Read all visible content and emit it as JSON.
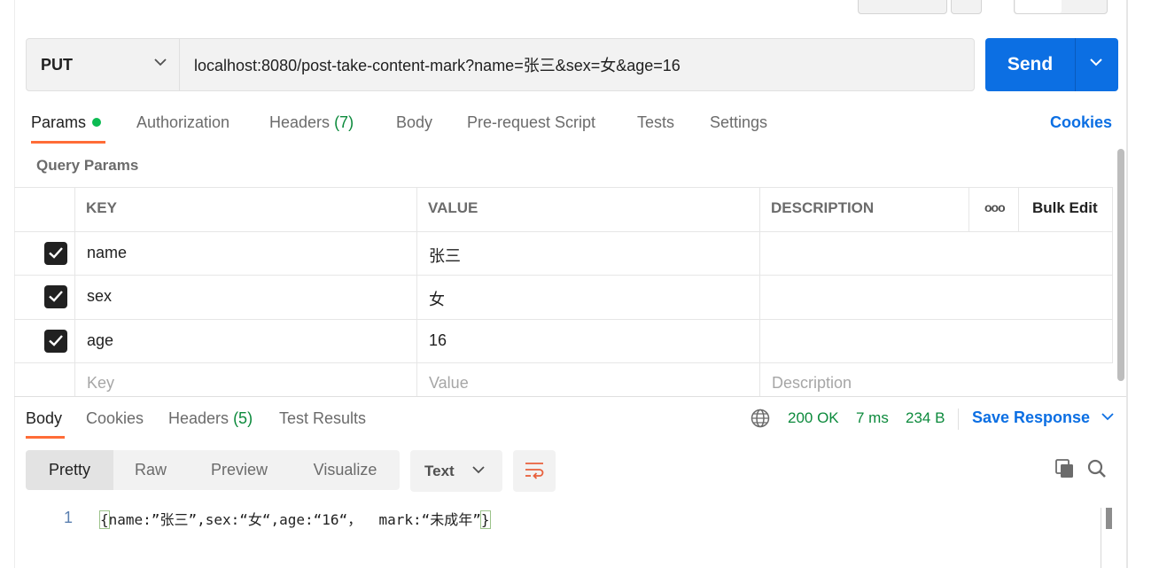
{
  "request": {
    "method": "PUT",
    "url": "localhost:8080/post-take-content-mark?name=张三&sex=女&age=16",
    "send_label": "Send"
  },
  "request_tabs": {
    "params": "Params",
    "authorization": "Authorization",
    "headers": "Headers",
    "headers_count": "(7)",
    "body": "Body",
    "pre_request": "Pre-request Script",
    "tests": "Tests",
    "settings": "Settings",
    "cookies": "Cookies"
  },
  "query_params": {
    "title": "Query Params",
    "columns": {
      "key": "KEY",
      "value": "VALUE",
      "description": "DESCRIPTION",
      "bulk_edit": "Bulk Edit",
      "more": "ooo"
    },
    "rows": [
      {
        "key": "name",
        "value": "张三",
        "checked": true
      },
      {
        "key": "sex",
        "value": "女",
        "checked": true
      },
      {
        "key": "age",
        "value": "16",
        "checked": true
      }
    ],
    "placeholders": {
      "key": "Key",
      "value": "Value",
      "description": "Description"
    }
  },
  "response": {
    "tabs": {
      "body": "Body",
      "cookies": "Cookies",
      "headers": "Headers",
      "headers_count": "(5)",
      "test_results": "Test Results"
    },
    "status": "200 OK",
    "time": "7 ms",
    "size": "234 B",
    "save_response": "Save Response",
    "views": {
      "pretty": "Pretty",
      "raw": "Raw",
      "preview": "Preview",
      "visualize": "Visualize"
    },
    "format": "Text",
    "line_number": "1",
    "body_open": "{",
    "body_text": "name:”张三”,sex:“女“,age:“16“，  mark:“未成年”",
    "body_close": "}"
  },
  "colors": {
    "accent": "#ff6c37",
    "send": "#0c6fe3",
    "status_ok": "#0c8a3c"
  }
}
